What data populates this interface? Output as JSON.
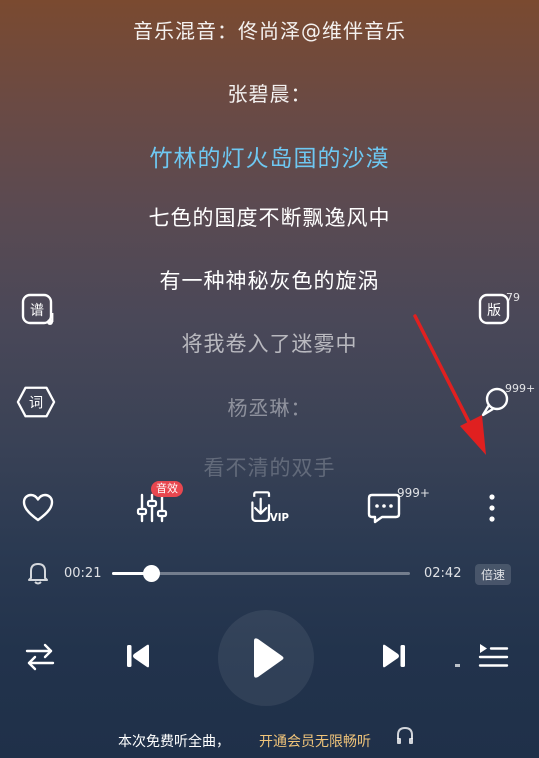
{
  "lyrics": {
    "credit_line": "音乐混音：佟尚泽@维伴音乐",
    "singer_1": "张碧晨：",
    "current_line": "竹林的灯火岛国的沙漠",
    "line_1": "七色的国度不断飘逸风中",
    "line_2": "有一种神秘灰色的旋涡",
    "line_3": "将我卷入了迷雾中",
    "singer_2": "杨丞琳：",
    "line_4": "看不清的双手"
  },
  "side": {
    "score_label": "谱",
    "lyrics_label": "词",
    "version_label": "版",
    "version_count": "79",
    "comment_count": "999+"
  },
  "actions": {
    "sound_effect_badge": "音效",
    "download_vip_label": "VIP",
    "comments_count": "999+"
  },
  "progress": {
    "elapsed": "00:21",
    "total": "02:42",
    "fraction": 0.13,
    "speed_label": "倍速"
  },
  "footer": {
    "free_text": "本次免费听全曲，",
    "vip_text": "开通会员无限畅听"
  },
  "colors": {
    "current_lyric": "#6ec8f2",
    "badge": "#e8474f",
    "vip_link": "#f0c47a",
    "annotation_arrow": "#e02020"
  },
  "icons": [
    "heart-icon",
    "equalizer-icon",
    "download-vip-icon",
    "comment-icon",
    "more-vertical-icon",
    "bell-icon",
    "repeat-icon",
    "previous-icon",
    "play-icon",
    "next-icon",
    "playlist-icon"
  ]
}
